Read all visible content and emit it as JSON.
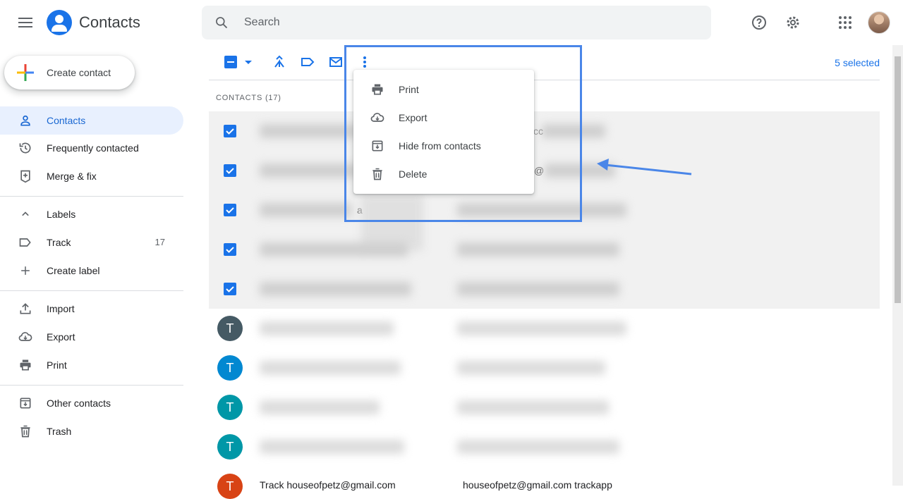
{
  "header": {
    "app_title": "Contacts",
    "search_placeholder": "Search"
  },
  "sidebar": {
    "create_label": "Create contact",
    "items": [
      {
        "label": "Contacts",
        "icon": "person-icon"
      },
      {
        "label": "Frequently contacted",
        "icon": "history-icon"
      },
      {
        "label": "Merge & fix",
        "icon": "merge-fix-icon"
      }
    ],
    "labels_header": "Labels",
    "labels": [
      {
        "label": "Track",
        "count": "17"
      }
    ],
    "create_label_item": "Create label",
    "actions": [
      {
        "label": "Import"
      },
      {
        "label": "Export"
      },
      {
        "label": "Print"
      }
    ],
    "bottom": [
      {
        "label": "Other contacts"
      },
      {
        "label": "Trash"
      }
    ]
  },
  "main": {
    "selected_text": "5 selected",
    "section_header": "CONTACTS (17)",
    "rows": [
      {
        "initial": "T",
        "color": "#455a64"
      },
      {
        "initial": "T",
        "color": "#0288d1"
      },
      {
        "initial": "T",
        "color": "#0097a7"
      },
      {
        "initial": "T",
        "color": "#0097a7"
      },
      {
        "initial": "T",
        "color": "#d84315"
      }
    ],
    "last_row_name": "Track houseofpetz@gmail.com",
    "last_row_email": "houseofpetz@gmail.com trackapp",
    "partial_text_1": "cc",
    "partial_text_2": "@",
    "partial_text_3": "a"
  },
  "menu": {
    "items": [
      {
        "label": "Print",
        "icon": "print-icon"
      },
      {
        "label": "Export",
        "icon": "cloud-download-icon"
      },
      {
        "label": "Hide from contacts",
        "icon": "archive-icon"
      },
      {
        "label": "Delete",
        "icon": "trash-icon"
      }
    ]
  },
  "colors": {
    "accent": "#1a73e8",
    "annotation": "#4a86e8"
  }
}
